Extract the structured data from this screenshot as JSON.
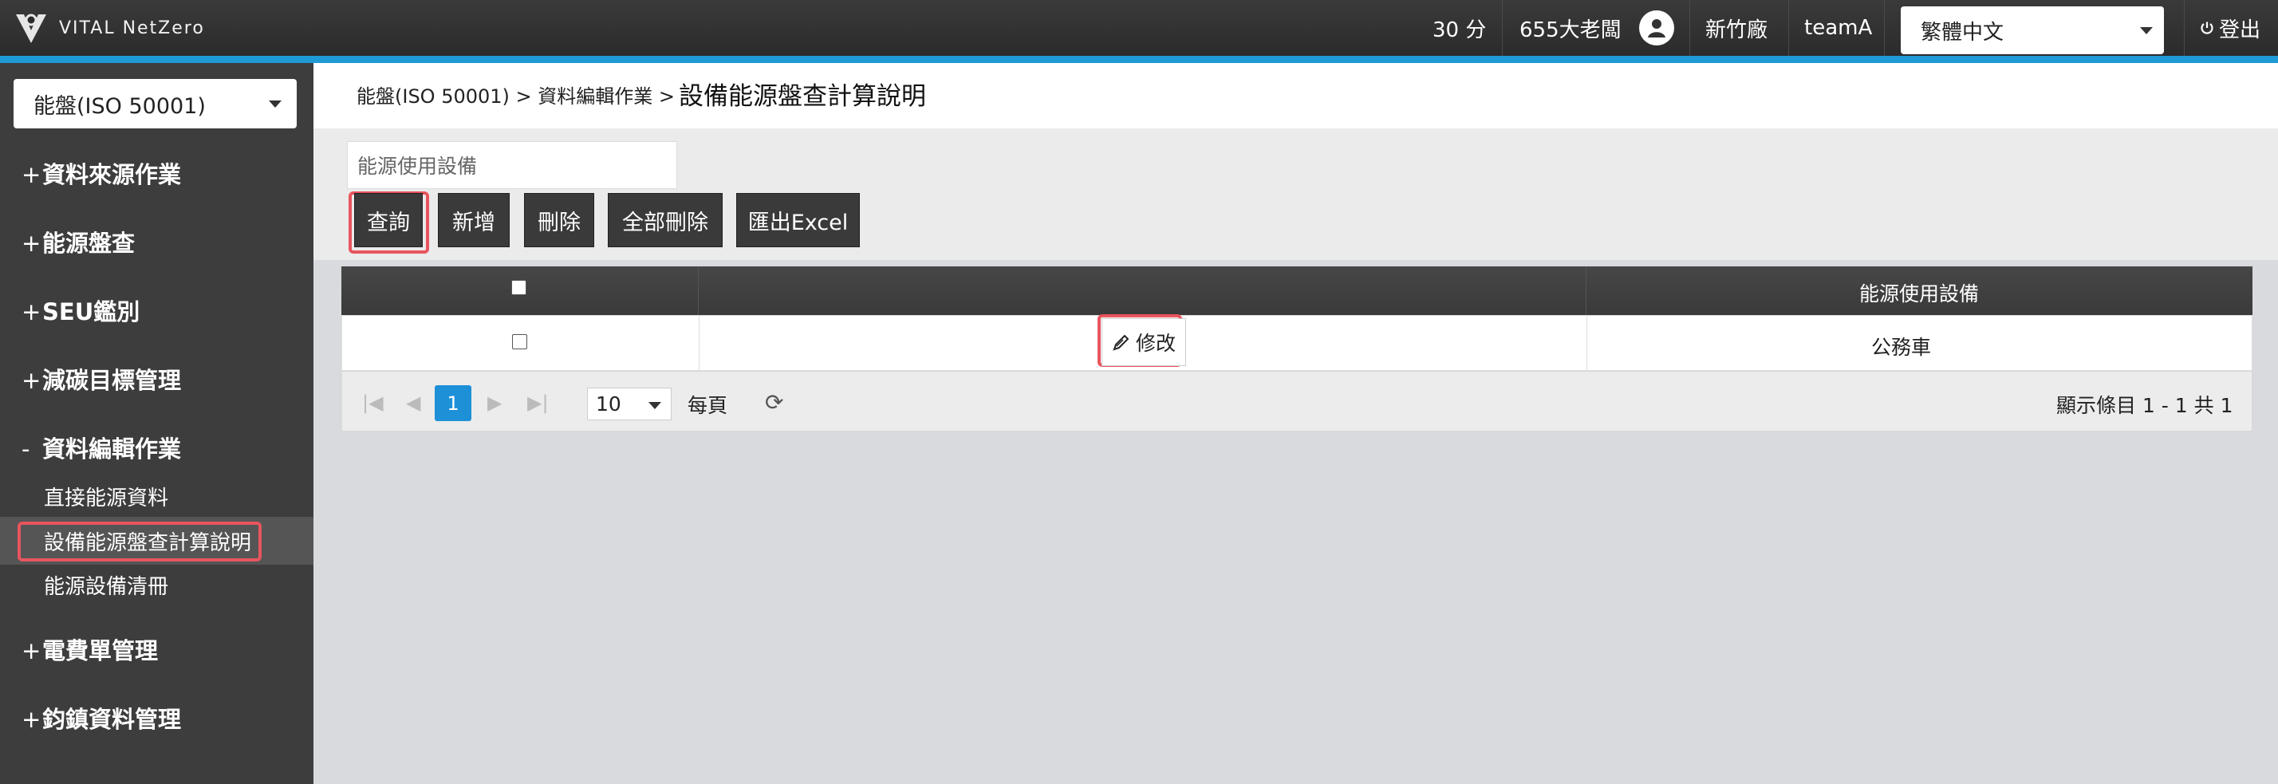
{
  "header": {
    "brand": "VITAL NetZero",
    "points": "30 分",
    "user_name": "655大老闆",
    "factory": "新竹廠",
    "team": "teamA",
    "language": "繁體中文",
    "logout_label": "登出",
    "accent_color": "#1e9ad6"
  },
  "sidebar": {
    "module": "能盤(ISO 50001)",
    "groups": [
      {
        "sign": "+",
        "label": "資料來源作業"
      },
      {
        "sign": "+",
        "label": "能源盤查"
      },
      {
        "sign": "+",
        "label": "SEU鑑別"
      },
      {
        "sign": "+",
        "label": "減碳目標管理"
      },
      {
        "sign": "-",
        "label": "資料編輯作業"
      },
      {
        "sign": "+",
        "label": "電費單管理"
      },
      {
        "sign": "+",
        "label": "鈞鎮資料管理"
      }
    ],
    "sub_items": [
      {
        "label": "直接能源資料"
      },
      {
        "label": "設備能源盤查計算說明",
        "active": true
      },
      {
        "label": "能源設備清冊"
      }
    ]
  },
  "breadcrumb": {
    "path": "能盤(ISO 50001) > 資料編輯作業 >",
    "current": "設備能源盤查計算說明"
  },
  "filter": {
    "placeholder": "能源使用設備"
  },
  "toolbar": {
    "query": "查詢",
    "add": "新增",
    "delete": "刪除",
    "delete_all": "全部刪除",
    "export_excel": "匯出Excel"
  },
  "grid": {
    "columns": [
      "",
      "",
      "能源使用設備"
    ],
    "rows": [
      {
        "edit_label": "修改",
        "device": "公務車"
      }
    ]
  },
  "pager": {
    "current_page": "1",
    "page_size": "10",
    "per_page_label": "每頁",
    "summary": "顯示條目 1 - 1 共 1"
  },
  "highlight_color": "#e8555e"
}
